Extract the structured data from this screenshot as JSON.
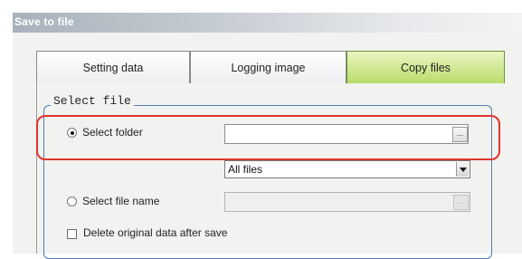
{
  "window": {
    "title": "Save to file"
  },
  "tabs": [
    {
      "label": "Setting data",
      "active": false
    },
    {
      "label": "Logging image",
      "active": false
    },
    {
      "label": "Copy files",
      "active": true
    }
  ],
  "group": {
    "legend": "Select file",
    "select_folder": {
      "label": "Select folder",
      "checked": true,
      "value": "",
      "browse": "..."
    },
    "filter": {
      "selected": "All files"
    },
    "select_file_name": {
      "label": "Select file name",
      "checked": false,
      "value": "",
      "browse": "..."
    },
    "delete_original": {
      "label": "Delete original data after save",
      "checked": false
    }
  },
  "colors": {
    "active_tab": "#b9dd6a",
    "group_border": "#4f7fb6",
    "highlight": "#e0362c"
  }
}
